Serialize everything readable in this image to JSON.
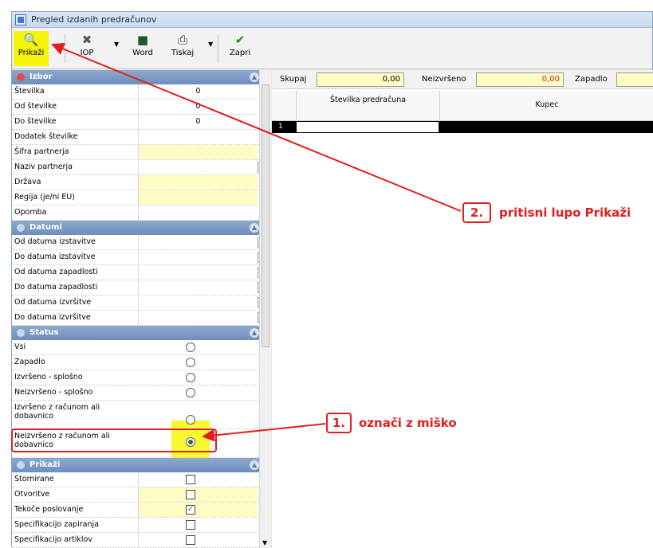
{
  "window": {
    "title": "Pregled izdanih predračunov"
  },
  "toolbar": {
    "buttons": [
      {
        "label": "Prikaži",
        "icon": "magnifier-icon"
      },
      {
        "label": "IOP",
        "icon": "iop-icon"
      },
      {
        "label": "Word",
        "icon": "word-icon"
      },
      {
        "label": "Tiskaj",
        "icon": "printer-icon"
      },
      {
        "label": "Zapri",
        "icon": "checkmark-icon"
      }
    ]
  },
  "sections": {
    "izbor": "Izbor",
    "datumi": "Datumi",
    "status": "Status",
    "prikazi": "Prikaži"
  },
  "izbor": [
    {
      "label": "Številka",
      "value": "0"
    },
    {
      "label": "Od številke",
      "value": "0"
    },
    {
      "label": "Do številke",
      "value": "0"
    },
    {
      "label": "Dodatek številke",
      "value": ""
    },
    {
      "label": "Šifra partnerja",
      "value": ""
    },
    {
      "label": "Naziv partnerja",
      "value": ""
    },
    {
      "label": "Država",
      "value": ""
    },
    {
      "label": "Regija (je/ni EU)",
      "value": ""
    },
    {
      "label": "Opomba",
      "value": ""
    }
  ],
  "datumi": [
    {
      "label": "Od datuma izstavitve"
    },
    {
      "label": "Do datuma izstavitve"
    },
    {
      "label": "Od datuma zapadlosti"
    },
    {
      "label": "Do datuma zapadlosti"
    },
    {
      "label": "Od datuma izvršitve"
    },
    {
      "label": "Do datuma izvršitve"
    }
  ],
  "status": [
    {
      "label": "Vsi",
      "selected": false
    },
    {
      "label": "Zapadlo",
      "selected": false
    },
    {
      "label": "Izvršeno - splošno",
      "selected": false
    },
    {
      "label": "Neizvršeno - splošno",
      "selected": false
    },
    {
      "label": "Izvršeno z računom ali dobavnico",
      "selected": false
    },
    {
      "label": "Neizvršeno z računom ali dobavnico",
      "selected": true
    }
  ],
  "prikazi": [
    {
      "label": "Stornirane",
      "checked": false
    },
    {
      "label": "Otvoritve",
      "checked": false
    },
    {
      "label": "Tekoče poslovanje",
      "checked": true
    },
    {
      "label": "Specifikacijo zapiranja",
      "checked": false
    },
    {
      "label": "Specifikacijo artiklov",
      "checked": false
    }
  ],
  "summary": {
    "skupaj_label": "Skupaj",
    "skupaj_value": "0,00",
    "neizvrseno_label": "Neizvršeno",
    "neizvrseno_value": "0,00",
    "zapadlo_label": "Zapadlo"
  },
  "grid": {
    "columns": [
      "Številka predračuna",
      "Kupec"
    ],
    "rows": [
      {
        "num": "1"
      }
    ]
  },
  "annotations": {
    "step1_num": "1.",
    "step1_text": "označi z miško",
    "step2_num": "2.",
    "step2_text": "pritisni lupo Prikaži"
  },
  "colors": {
    "highlight": "#f4f40a",
    "annotation": "#e01e1e",
    "section_header": "#7b9bc6",
    "field_yellow": "#fffcc4"
  }
}
